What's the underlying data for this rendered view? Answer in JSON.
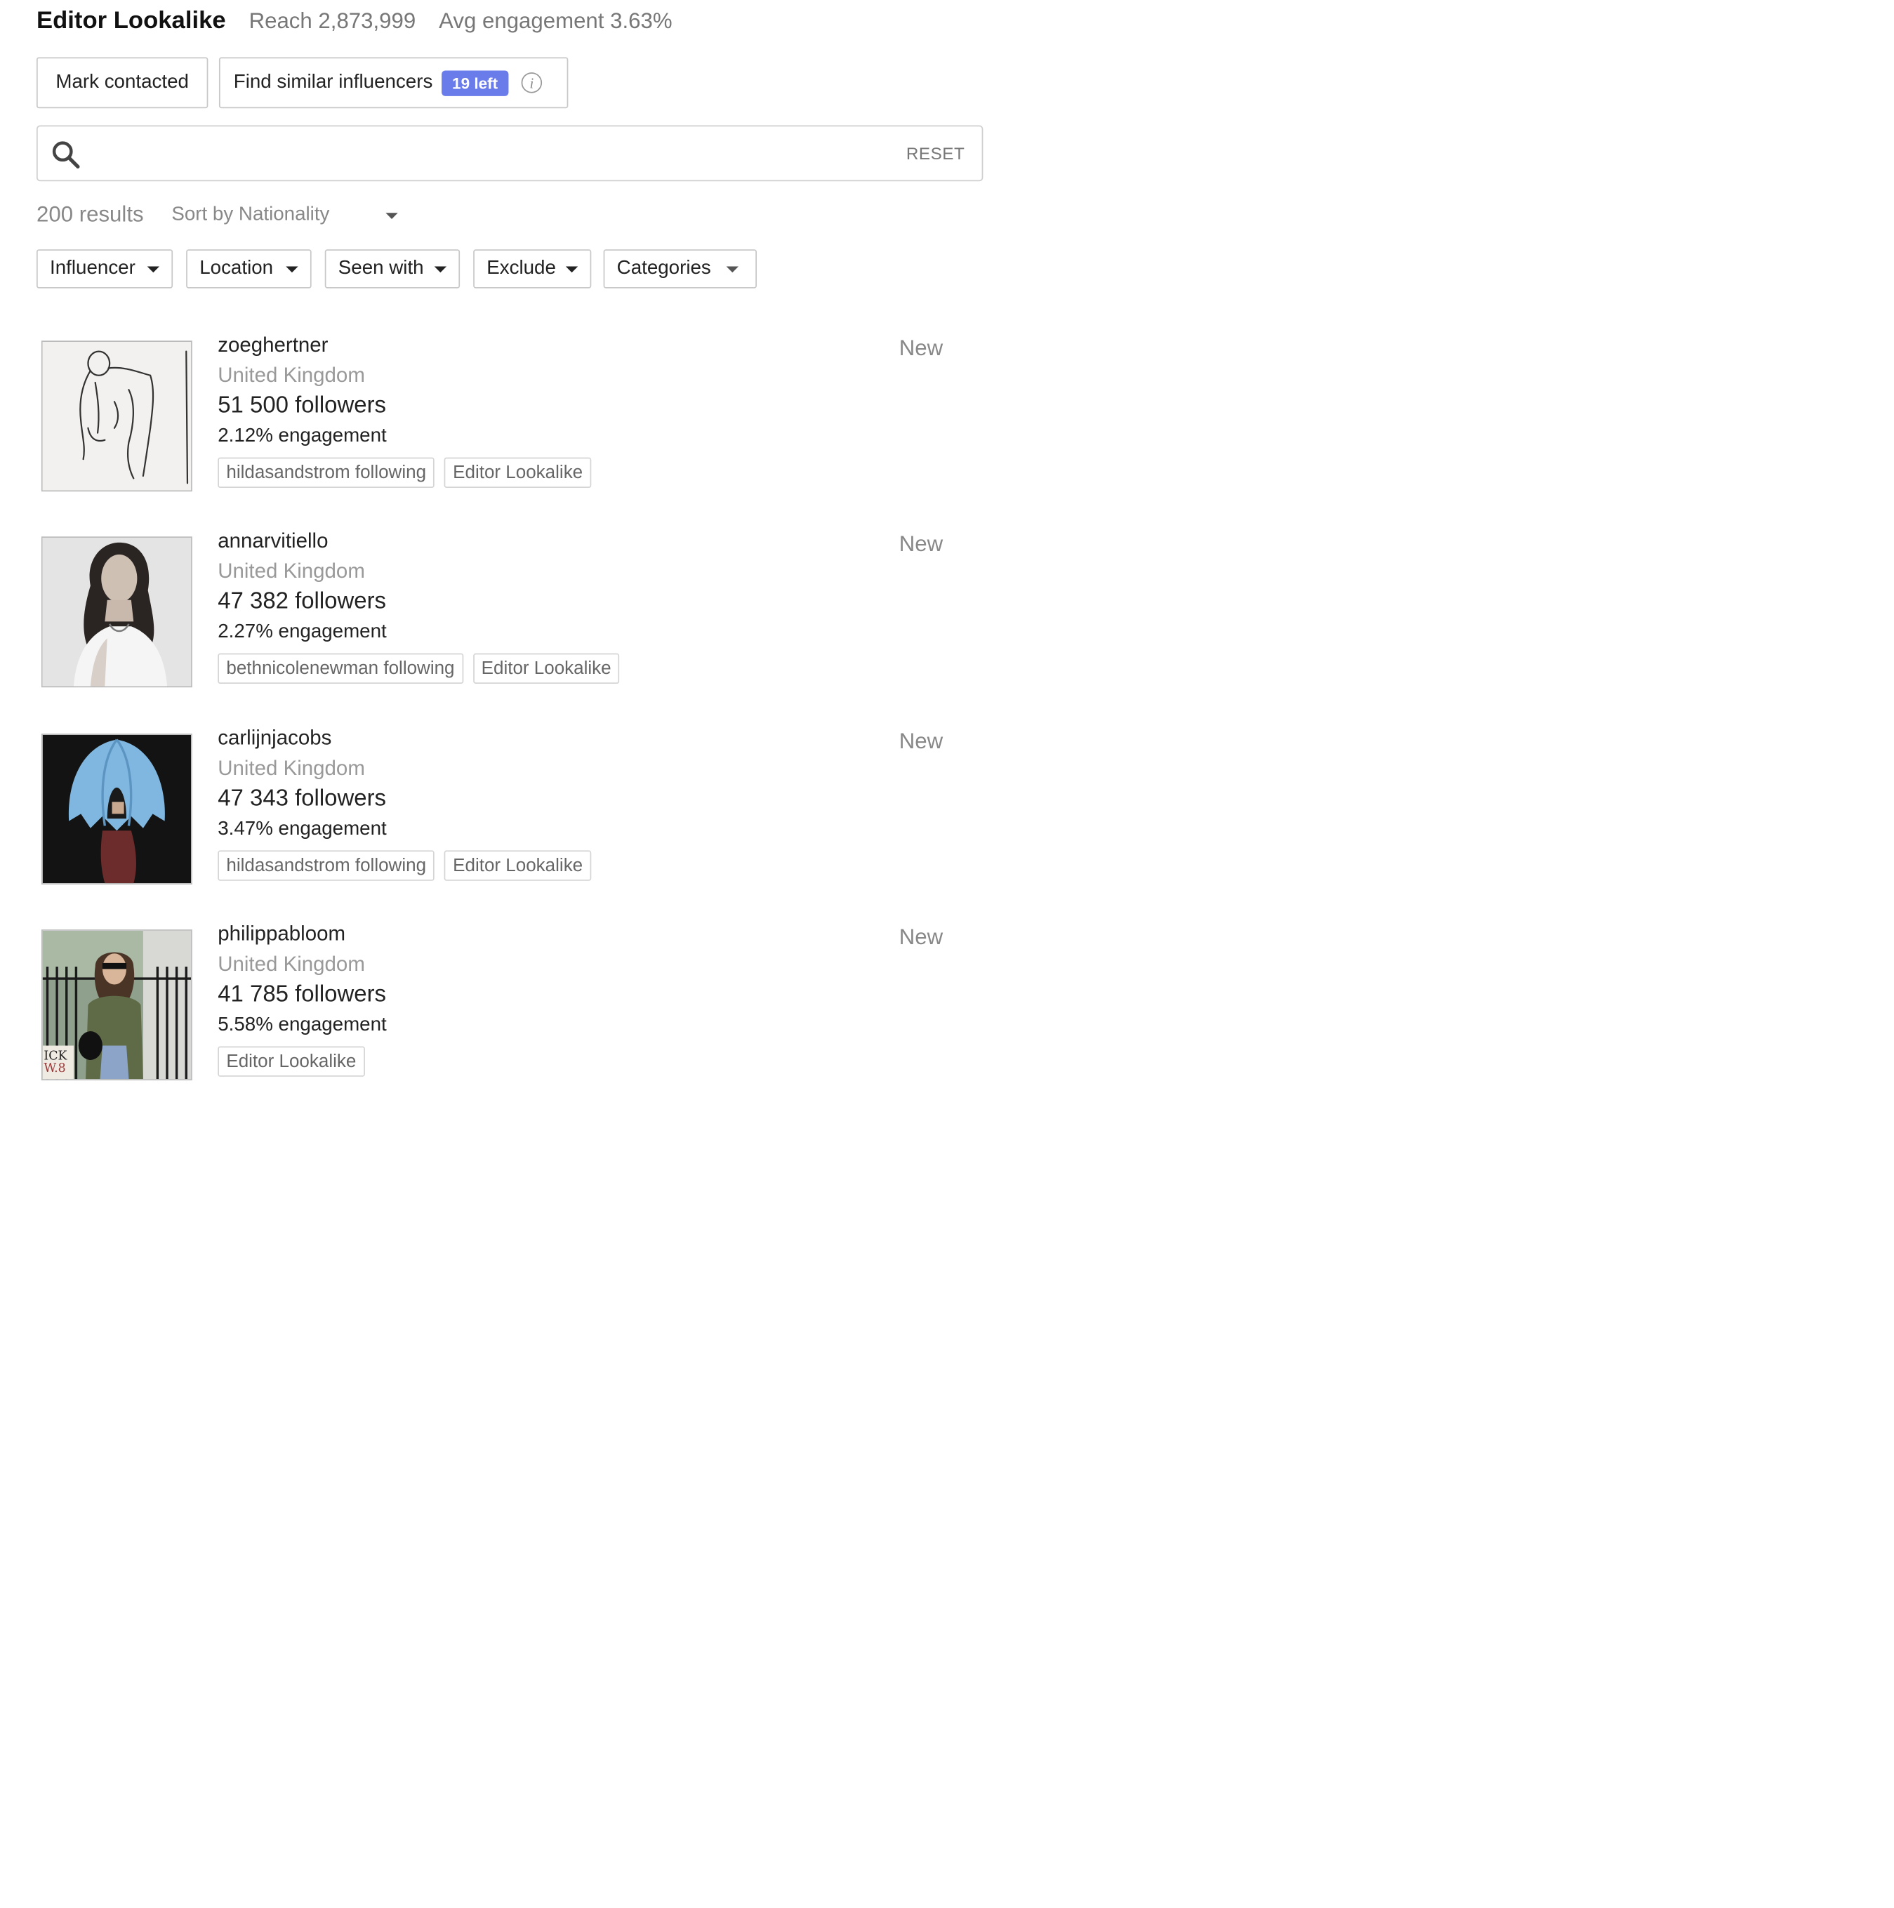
{
  "header": {
    "title": "Editor Lookalike",
    "reach": "Reach 2,873,999",
    "engagement": "Avg engagement 3.63%"
  },
  "actions": {
    "mark_contacted": "Mark contacted",
    "find_similar": "Find similar influencers",
    "left_badge": "19 left",
    "badge_color": "#6a7bea"
  },
  "search": {
    "value": "",
    "reset_label": "RESET",
    "icon": "search-icon"
  },
  "results": {
    "count_label": "200 results",
    "sort_label": "Sort by Nationality"
  },
  "filters": [
    "Influencer",
    "Location",
    "Seen with",
    "Exclude",
    "Categories"
  ],
  "influencers": [
    {
      "username": "zoeghertner",
      "country": "United Kingdom",
      "followers": "51 500 followers",
      "engagement": "2.12% engagement",
      "tags": [
        "hildasandstrom following",
        "Editor Lookalike"
      ],
      "status": "New"
    },
    {
      "username": "annarvitiello",
      "country": "United Kingdom",
      "followers": "47 382 followers",
      "engagement": "2.27% engagement",
      "tags": [
        "bethnicolenewman following",
        "Editor Lookalike"
      ],
      "status": "New"
    },
    {
      "username": "carlijnjacobs",
      "country": "United Kingdom",
      "followers": "47 343 followers",
      "engagement": "3.47% engagement",
      "tags": [
        "hildasandstrom following",
        "Editor Lookalike"
      ],
      "status": "New"
    },
    {
      "username": "philippabloom",
      "country": "United Kingdom",
      "followers": "41 785 followers",
      "engagement": "5.58% engagement",
      "tags": [
        "Editor Lookalike"
      ],
      "status": "New",
      "photo_text": [
        "ICK",
        "W.8"
      ]
    }
  ]
}
